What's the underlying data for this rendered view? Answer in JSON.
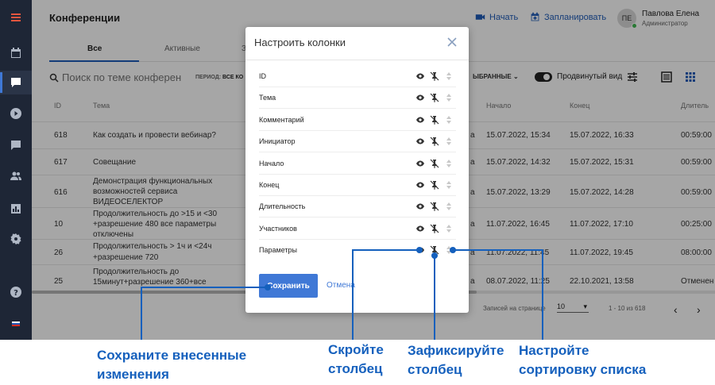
{
  "header": {
    "title": "Конференции",
    "start_label": "Начать",
    "schedule_label": "Запланировать"
  },
  "user": {
    "initials": "ПЕ",
    "name": "Павлова Елена",
    "role": "Администратор"
  },
  "tabs": [
    {
      "label": "Все"
    },
    {
      "label": "Активные"
    },
    {
      "label": "З"
    }
  ],
  "search": {
    "placeholder": "Поиск по теме конферен"
  },
  "filter": {
    "period_label": "ПЕРИОД:",
    "period_value": "ВСЕ КО",
    "selected_label": "ЫБРАННЫЕ",
    "advanced_view": "Продвинутый вид"
  },
  "table": {
    "columns": [
      "ID",
      "Тема",
      "Начало",
      "Конец",
      "Длитель"
    ],
    "rows": [
      {
        "id": "618",
        "topic": [
          "Как создать и провести вебинар?"
        ],
        "extra": "а",
        "start": "15.07.2022, 15:34",
        "end": "15.07.2022, 16:33",
        "duration": "00:59:00"
      },
      {
        "id": "617",
        "topic": [
          "Совещание"
        ],
        "extra": "а",
        "start": "15.07.2022, 14:32",
        "end": "15.07.2022, 15:31",
        "duration": "00:59:00"
      },
      {
        "id": "616",
        "topic": [
          "Демонстрация функциональных",
          "возможностей сервиса",
          "ВИДЕОСЕЛЕКТОР"
        ],
        "extra": "а",
        "start": "15.07.2022, 13:29",
        "end": "15.07.2022, 14:28",
        "duration": "00:59:00"
      },
      {
        "id": "10",
        "topic": [
          "Продолжительность до >15 и <30",
          "+разрешение 480 все параметры",
          "отключены"
        ],
        "extra": "а",
        "start": "11.07.2022, 16:45",
        "end": "11.07.2022, 17:10",
        "duration": "00:25:00"
      },
      {
        "id": "26",
        "topic": [
          "Продолжительность > 1ч и <24ч",
          "+разрешение 720"
        ],
        "extra": "а",
        "start": "11.07.2022, 11:45",
        "end": "11.07.2022, 19:45",
        "duration": "08:00:00"
      },
      {
        "id": "25",
        "topic": [
          "Продолжительность до",
          "15минут+разрешение 360+все"
        ],
        "extra": "а",
        "start": "08.07.2022, 11:25",
        "end": "22.10.2021, 13:58",
        "duration": "Отменен"
      }
    ]
  },
  "pager": {
    "rows_label": "Записей на странице",
    "page_size": "10",
    "range": "1 - 10 из 618"
  },
  "modal": {
    "title": "Настроить колонки",
    "columns": [
      "ID",
      "Тема",
      "Комментарий",
      "Инициатор",
      "Начало",
      "Конец",
      "Длительность",
      "Участников",
      "Параметры"
    ],
    "save_label": "Сохранить",
    "cancel_label": "Отмена"
  },
  "callouts": {
    "save": [
      "Сохраните внесенные",
      "изменения"
    ],
    "hide": [
      "Скройте",
      "столбец"
    ],
    "pin": [
      "Зафиксируйте",
      "столбец"
    ],
    "sort": [
      "Настройте",
      "сортировку списка"
    ]
  },
  "colors": {
    "accent": "#3f78d6",
    "callout": "#1560bd",
    "sidebar": "#1e2636"
  },
  "icons": [
    "menu-icon",
    "calendar-icon",
    "conference-icon",
    "play-icon",
    "chat-icon",
    "users-icon",
    "chart-icon",
    "settings-icon",
    "help-icon",
    "flag-icon",
    "eye-icon",
    "pin-off-icon",
    "sort-icon",
    "close-icon",
    "search-icon"
  ]
}
